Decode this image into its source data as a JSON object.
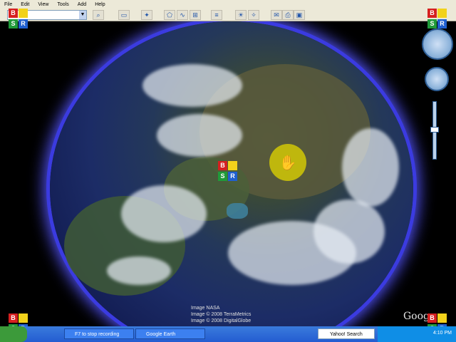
{
  "menu": [
    "File",
    "Edit",
    "View",
    "Tools",
    "Add",
    "Help"
  ],
  "map": {
    "credits": [
      "Image NASA",
      "Image © 2008 TerraMetrics",
      "Image © 2008 DigitalGlobe"
    ],
    "watermark": "Goog"
  },
  "overlay_badges": [
    "B",
    "S",
    "R"
  ],
  "taskbar": {
    "items": [
      "F7 to stop recording",
      "Google Earth"
    ],
    "search_placeholder": "Yahoo! Search",
    "clock": "4:10 PM"
  }
}
